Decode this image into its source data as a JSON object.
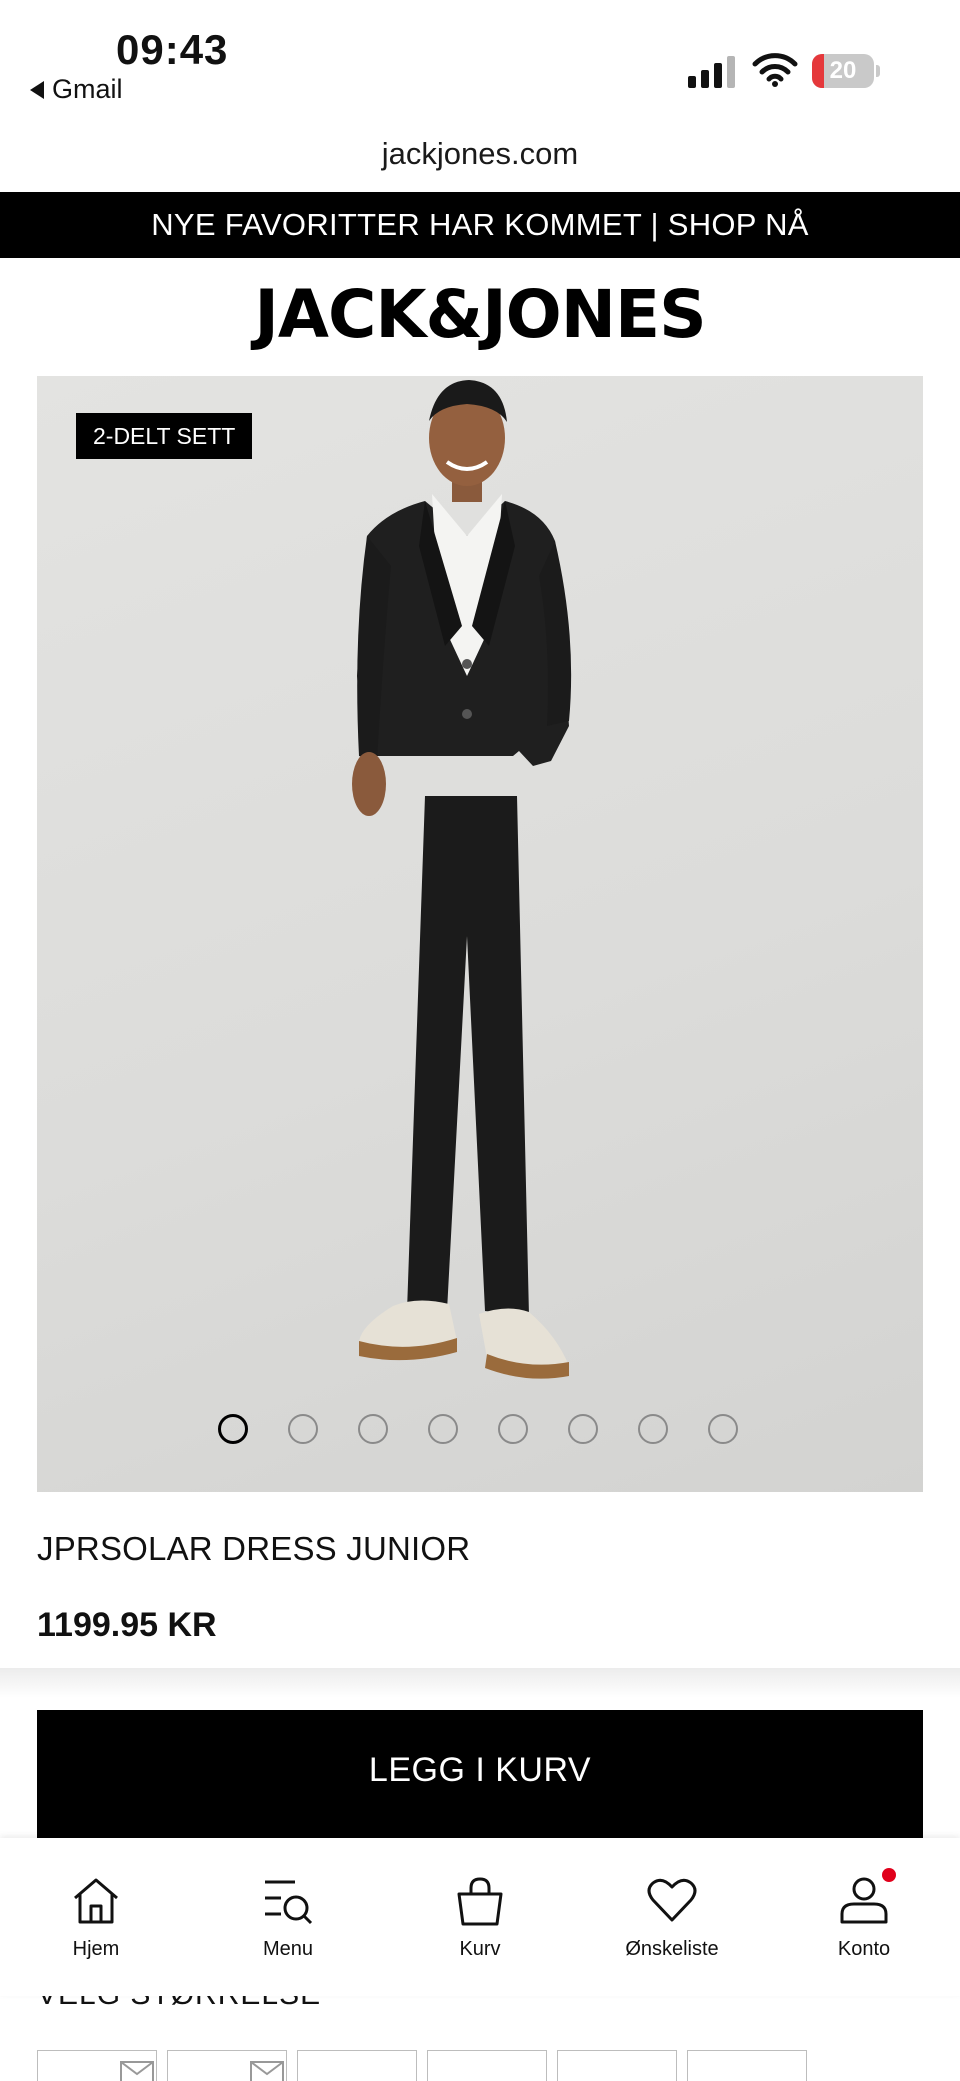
{
  "status_bar": {
    "time": "09:43",
    "back_app": "Gmail",
    "battery_level": "20",
    "battery_fraction": 0.2,
    "icons": [
      "signal-icon",
      "wifi-icon",
      "battery-icon"
    ]
  },
  "browser": {
    "url": "jackjones.com"
  },
  "promo": {
    "text": "NYE FAVORITTER HAR KOMMET | SHOP NÅ"
  },
  "brand": {
    "logo": "JACK&JONES"
  },
  "product": {
    "tag": "2-DELT SETT",
    "title": "JPRSOLAR DRESS JUNIOR",
    "price": "1199.95 KR",
    "carousel": {
      "total": 8,
      "active": 1
    },
    "add_to_cart": "LEGG I KURV",
    "size_label": "VELG STØRRELSE"
  },
  "tab_bar": {
    "items": [
      {
        "label": "Hjem",
        "icon": "home-icon"
      },
      {
        "label": "Menu",
        "icon": "menu-search-icon"
      },
      {
        "label": "Kurv",
        "icon": "bag-icon"
      },
      {
        "label": "Ønskeliste",
        "icon": "heart-icon"
      },
      {
        "label": "Konto",
        "icon": "account-icon"
      }
    ]
  },
  "colors": {
    "accent": "#000000",
    "notification": "#e0001b",
    "battery_low": "#e5383b"
  }
}
